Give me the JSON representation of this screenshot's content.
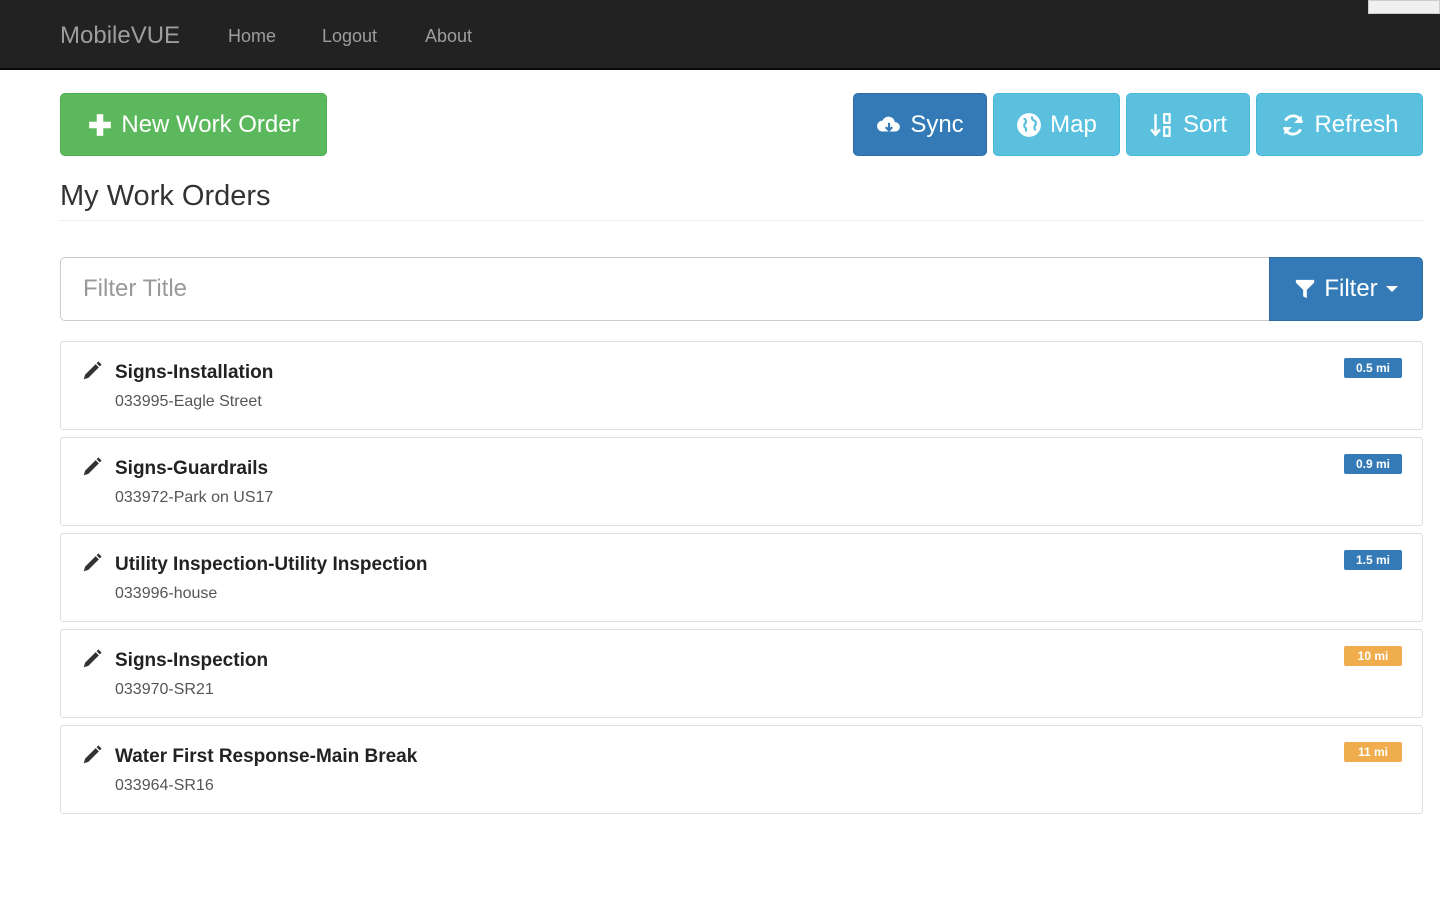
{
  "nav": {
    "brand": "MobileVUE",
    "links": [
      "Home",
      "Logout",
      "About"
    ]
  },
  "toolbar": {
    "new_work_order": "New Work Order",
    "sync": "Sync",
    "map": "Map",
    "sort": "Sort",
    "refresh": "Refresh"
  },
  "page": {
    "title": "My Work Orders"
  },
  "filter": {
    "placeholder": "Filter Title",
    "button_label": "Filter"
  },
  "colors": {
    "navbar": "#222222",
    "success": "#5cb85c",
    "primary": "#337ab7",
    "info": "#5bc0de",
    "badge_near": "#337ab7",
    "badge_far": "#f0ad4e"
  },
  "work_orders": [
    {
      "title": "Signs-Installation",
      "subtitle": "033995-Eagle Street",
      "distance": "0.5 mi",
      "badge_color": "#337ab7"
    },
    {
      "title": "Signs-Guardrails",
      "subtitle": "033972-Park on US17",
      "distance": "0.9 mi",
      "badge_color": "#337ab7"
    },
    {
      "title": "Utility Inspection-Utility Inspection",
      "subtitle": "033996-house",
      "distance": "1.5 mi",
      "badge_color": "#337ab7"
    },
    {
      "title": "Signs-Inspection",
      "subtitle": "033970-SR21",
      "distance": "10 mi",
      "badge_color": "#f0ad4e"
    },
    {
      "title": "Water First Response-Main Break",
      "subtitle": "033964-SR16",
      "distance": "11 mi",
      "badge_color": "#f0ad4e"
    }
  ]
}
